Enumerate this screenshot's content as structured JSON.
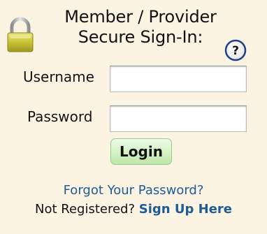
{
  "signin": {
    "title_line1": "Member / Provider",
    "title_line2": "Secure Sign-In:",
    "lock_icon": "padlock-icon",
    "help_icon_glyph": "?",
    "username_label": "Username",
    "username_value": "",
    "password_label": "Password",
    "password_value": "",
    "login_label": "Login",
    "forgot_link": "Forgot Your Password?",
    "register_text": "Not Registered?",
    "signup_link": "Sign Up Here"
  },
  "colors": {
    "background": "#fcf4e2",
    "link": "#1f5b95",
    "button": "#d4f2c4",
    "lock": "#b7b22d"
  }
}
